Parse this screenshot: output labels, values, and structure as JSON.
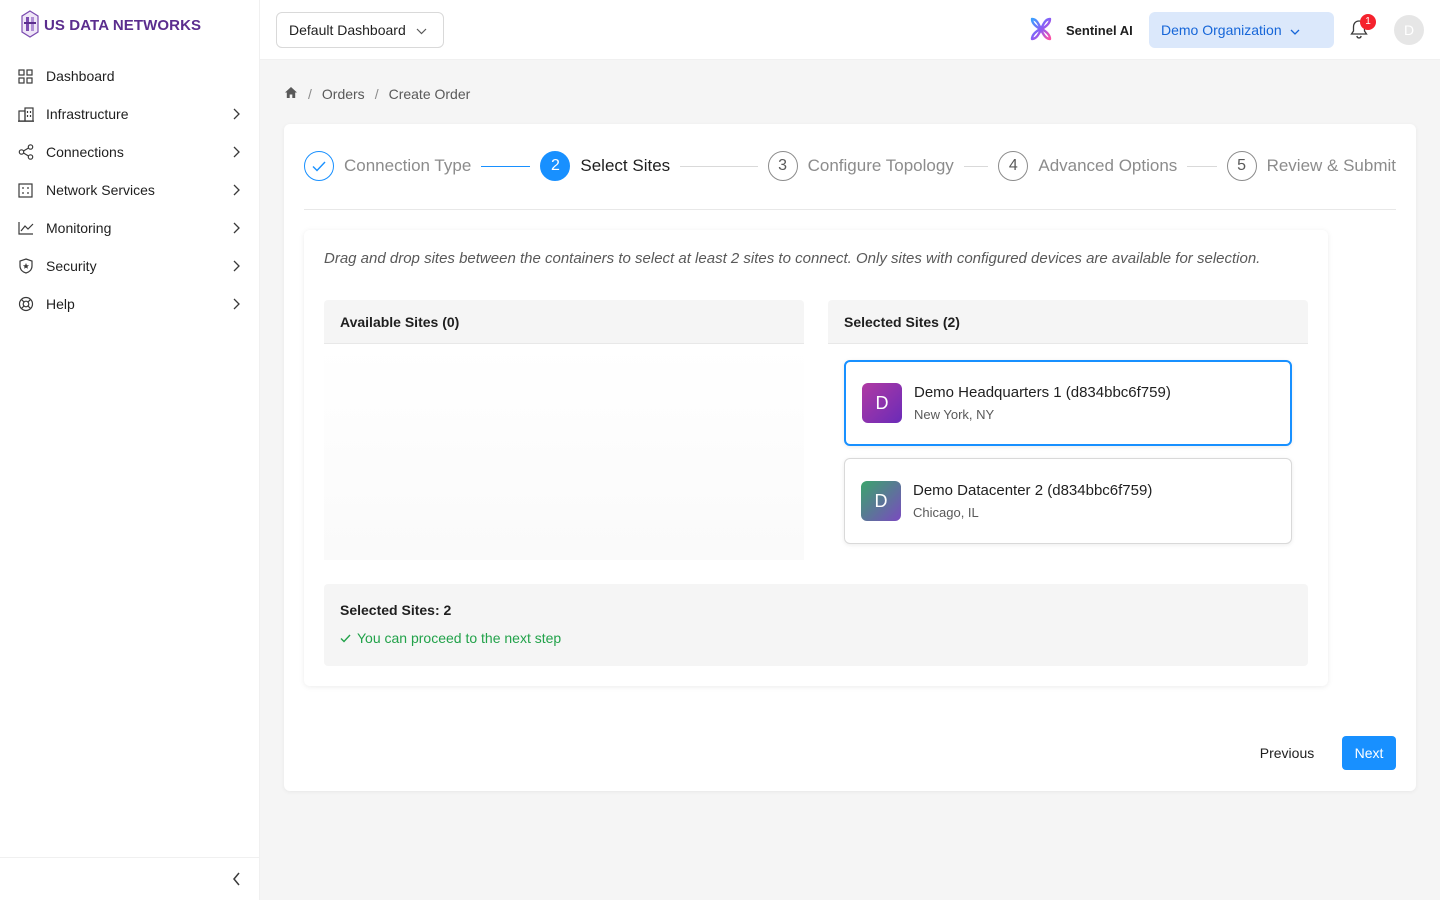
{
  "brand": {
    "name": "US DATA NETWORKS",
    "icon": "hexagon-logo-icon",
    "color": "#5b2d8e"
  },
  "sidebar": {
    "items": [
      {
        "label": "Dashboard",
        "icon": "grid-icon",
        "has_children": false
      },
      {
        "label": "Infrastructure",
        "icon": "building-icon",
        "has_children": true
      },
      {
        "label": "Connections",
        "icon": "share-nodes-icon",
        "has_children": true
      },
      {
        "label": "Network Services",
        "icon": "server-grid-icon",
        "has_children": true
      },
      {
        "label": "Monitoring",
        "icon": "line-chart-icon",
        "has_children": true
      },
      {
        "label": "Security",
        "icon": "shield-icon",
        "has_children": true
      },
      {
        "label": "Help",
        "icon": "lifebuoy-icon",
        "has_children": true
      }
    ],
    "collapse_icon": "chevron-left-icon"
  },
  "header": {
    "dashboard_select": "Default Dashboard",
    "assistant_label": "Sentinel AI",
    "organization_select": "Demo Organization",
    "notifications_count": "1",
    "avatar_initial": "D",
    "accent": "#1666d8"
  },
  "breadcrumb": {
    "home_icon": "home-icon",
    "items": [
      "Orders",
      "Create Order"
    ],
    "separator": "/"
  },
  "steps": [
    {
      "number": "1",
      "label": "Connection Type",
      "status": "done"
    },
    {
      "number": "2",
      "label": "Select Sites",
      "status": "active"
    },
    {
      "number": "3",
      "label": "Configure Topology",
      "status": "pending"
    },
    {
      "number": "4",
      "label": "Advanced Options",
      "status": "pending"
    },
    {
      "number": "5",
      "label": "Review & Submit",
      "status": "pending"
    }
  ],
  "select_sites": {
    "instructions": "Drag and drop sites between the containers to select at least 2 sites to connect. Only sites with configured devices are available for selection.",
    "available_title": "Available Sites (0)",
    "selected_title": "Selected Sites (2)",
    "selected_sites": [
      {
        "initial": "D",
        "name": "Demo Headquarters 1 (d834bbc6f759)",
        "location": "New York, NY",
        "color_from": "#b03aa3",
        "color_to": "#6a2bb8"
      },
      {
        "initial": "D",
        "name": "Demo Datacenter 2 (d834bbc6f759)",
        "location": "Chicago, IL",
        "color_from": "#3aa56b",
        "color_to": "#7a4ac0"
      }
    ],
    "summary_count": "Selected Sites: 2",
    "summary_status": "You can proceed to the next step",
    "status_color": "#22a24a"
  },
  "actions": {
    "previous": "Previous",
    "next": "Next",
    "primary_color": "#1890ff"
  }
}
